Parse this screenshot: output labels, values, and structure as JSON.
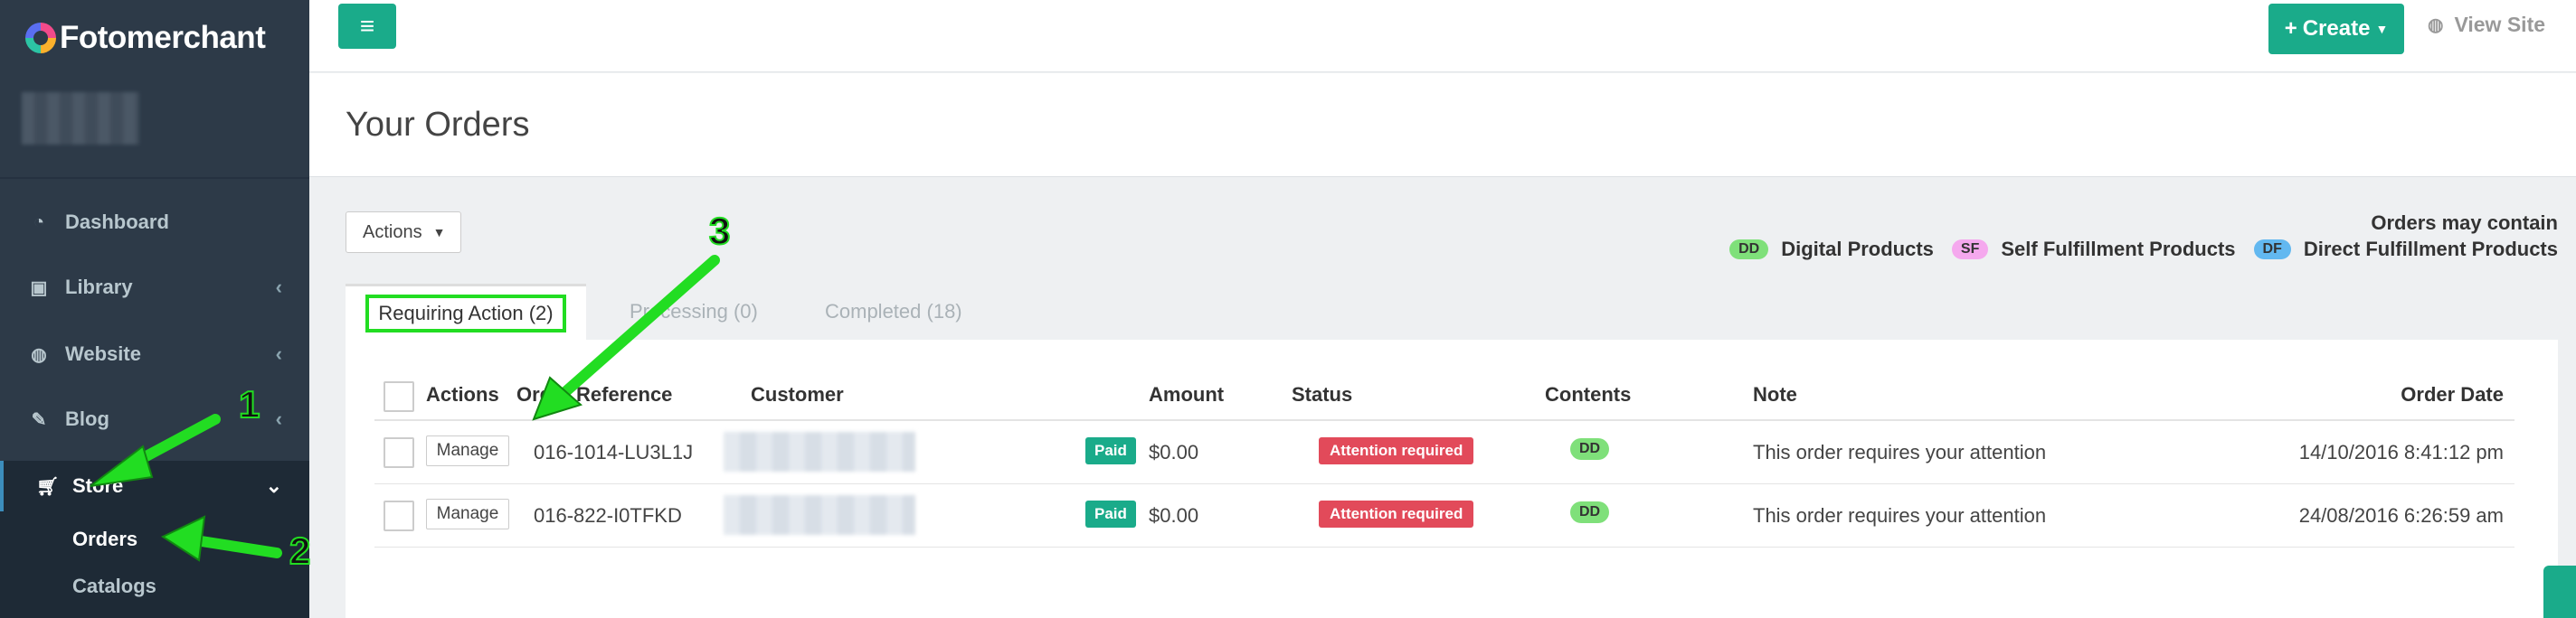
{
  "brand": {
    "name": "Fotomerchant"
  },
  "sidebar": {
    "items": [
      {
        "label": "Dashboard",
        "icon": "dashboard-icon"
      },
      {
        "label": "Library",
        "icon": "image-icon"
      },
      {
        "label": "Website",
        "icon": "globe-icon"
      },
      {
        "label": "Blog",
        "icon": "edit-icon"
      },
      {
        "label": "Store",
        "icon": "cart-icon"
      }
    ],
    "store_subitems": [
      {
        "label": "Orders"
      },
      {
        "label": "Catalogs"
      }
    ]
  },
  "header": {
    "create_label": "Create",
    "view_site_label": "View Site"
  },
  "page": {
    "title": "Your Orders",
    "actions_label": "Actions"
  },
  "legend": {
    "title": "Orders may contain",
    "items": [
      {
        "code": "DD",
        "label": "Digital Products",
        "color": "#7fe07a"
      },
      {
        "code": "SF",
        "label": "Self Fulfillment Products",
        "color": "#f5a8ee"
      },
      {
        "code": "DF",
        "label": "Direct Fulfillment Products",
        "color": "#62b8f0"
      }
    ]
  },
  "tabs": [
    {
      "label": "Requiring Action (2)",
      "active": true
    },
    {
      "label": "Processing (0)",
      "active": false
    },
    {
      "label": "Completed (18)",
      "active": false
    }
  ],
  "table": {
    "columns": [
      "Actions",
      "Order Reference",
      "Customer",
      "Amount",
      "Status",
      "Contents",
      "Note",
      "Order Date"
    ],
    "rows": [
      {
        "action": "Manage",
        "reference": "016-1014-LU3L1J",
        "payment": "Paid",
        "amount": "$0.00",
        "status": "Attention required",
        "contents": "DD",
        "note": "This order requires your attention",
        "date": "14/10/2016 8:41:12 pm"
      },
      {
        "action": "Manage",
        "reference": "016-822-I0TFKD",
        "payment": "Paid",
        "amount": "$0.00",
        "status": "Attention required",
        "contents": "DD",
        "note": "This order requires your attention",
        "date": "24/08/2016 6:26:59 am"
      }
    ]
  },
  "annotations": {
    "one": "1",
    "two": "2",
    "three": "3",
    "color": "#22dd22"
  }
}
